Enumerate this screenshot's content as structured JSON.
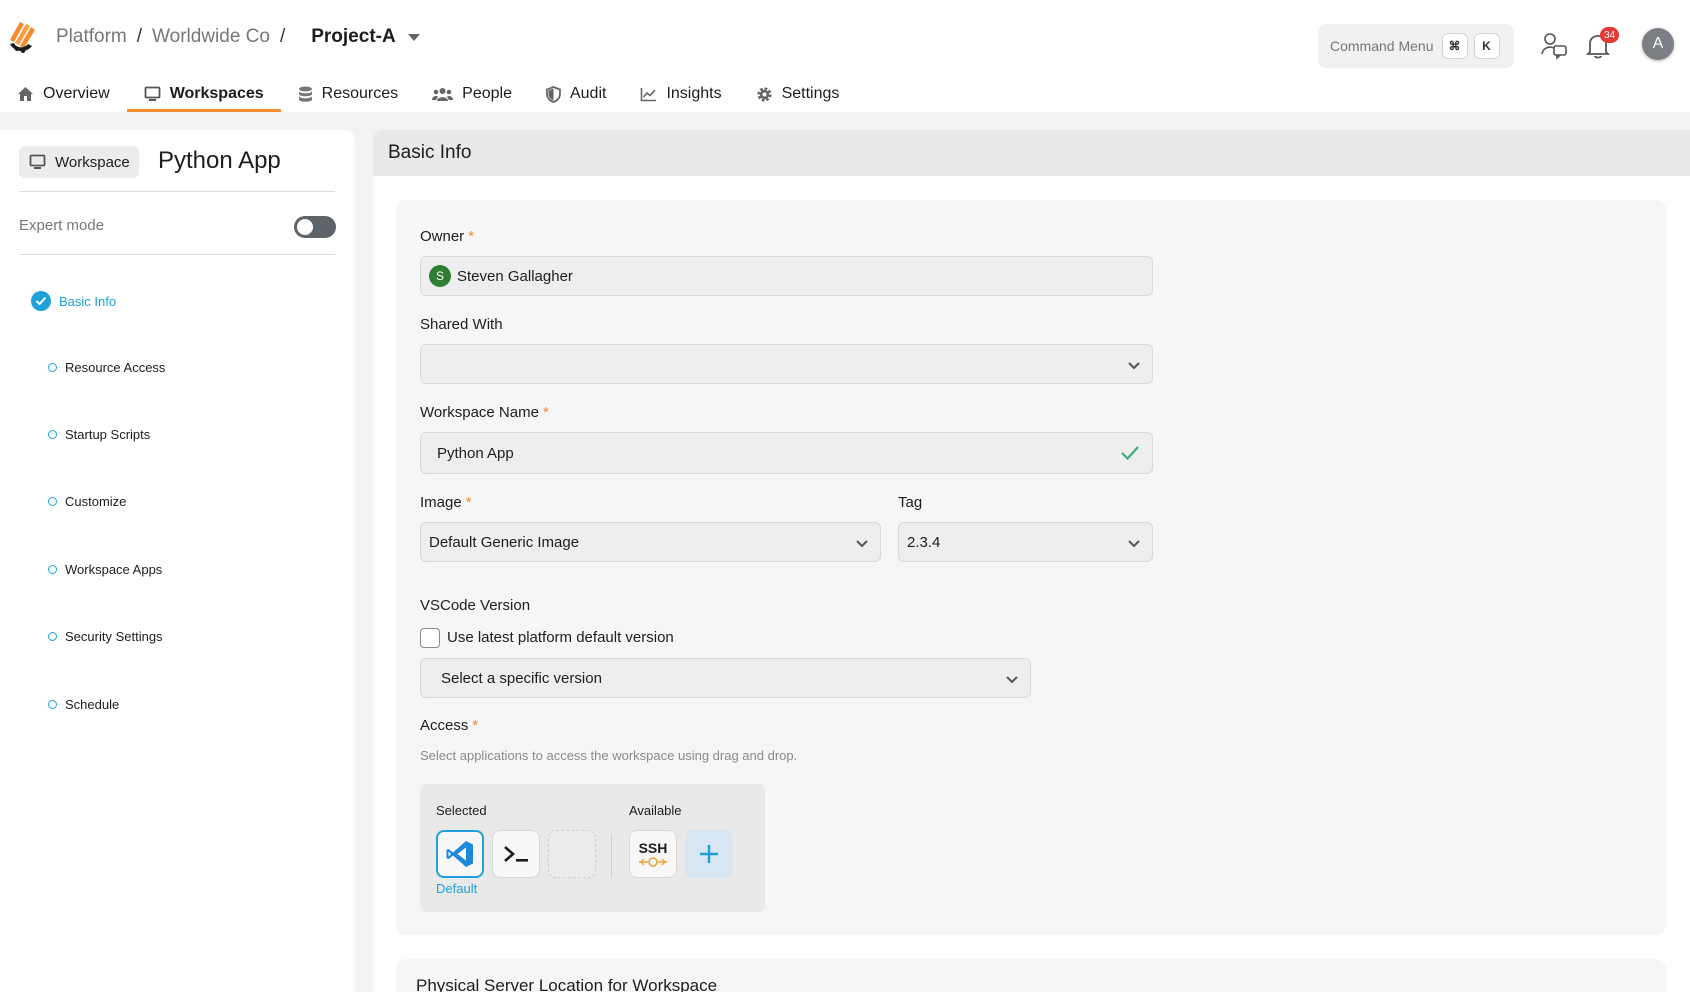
{
  "header": {
    "breadcrumb": [
      "Platform",
      "Worldwide Co",
      "Project-A"
    ],
    "command_menu": {
      "label": "Command Menu",
      "keys": [
        "⌘",
        "K"
      ]
    },
    "notification_count": "34",
    "user_initial": "A"
  },
  "tabs": [
    {
      "label": "Overview",
      "icon": "home-icon"
    },
    {
      "label": "Workspaces",
      "icon": "monitor-icon",
      "active": true
    },
    {
      "label": "Resources",
      "icon": "database-icon"
    },
    {
      "label": "People",
      "icon": "people-icon"
    },
    {
      "label": "Audit",
      "icon": "shield-icon"
    },
    {
      "label": "Insights",
      "icon": "chart-icon"
    },
    {
      "label": "Settings",
      "icon": "gear-icon"
    }
  ],
  "sidebar": {
    "chip_label": "Workspace",
    "title": "Python App",
    "expert_mode_label": "Expert mode",
    "expert_mode_on": false,
    "steps": [
      {
        "label": "Basic Info",
        "active": true
      },
      {
        "label": "Resource Access"
      },
      {
        "label": "Startup Scripts"
      },
      {
        "label": "Customize"
      },
      {
        "label": "Workspace Apps"
      },
      {
        "label": "Security Settings"
      },
      {
        "label": "Schedule"
      }
    ]
  },
  "main": {
    "section_title": "Basic Info",
    "owner": {
      "label": "Owner",
      "value": "Steven Gallagher",
      "initial": "S"
    },
    "shared_with": {
      "label": "Shared With",
      "value": ""
    },
    "workspace_name": {
      "label": "Workspace Name",
      "value": "Python App"
    },
    "image": {
      "label": "Image",
      "value": "Default Generic Image"
    },
    "tag": {
      "label": "Tag",
      "value": "2.3.4"
    },
    "vscode": {
      "label": "VSCode Version",
      "checkbox_label": "Use latest platform default version",
      "checked": false,
      "select_value": "Select a specific version"
    },
    "access": {
      "label": "Access",
      "hint": "Select applications to access the workspace using drag and drop.",
      "selected_label": "Selected",
      "available_label": "Available",
      "default_label": "Default",
      "ssh_label": "SSH"
    },
    "next_section_title": "Physical Server Location for Workspace"
  },
  "colors": {
    "accent": "#f48c2c",
    "primary": "#1da1d8",
    "owner_avatar": "#2e7d32"
  }
}
